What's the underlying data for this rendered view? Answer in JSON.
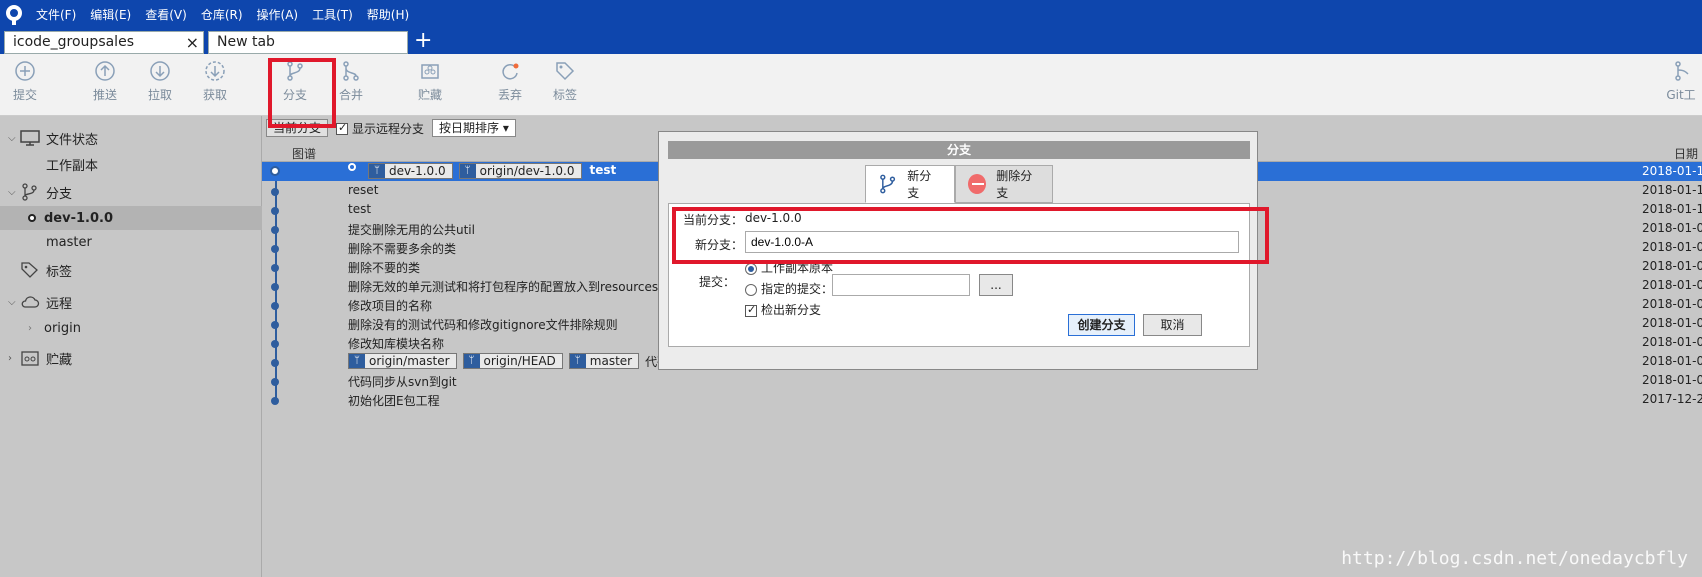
{
  "menubar": {
    "items": [
      "文件(F)",
      "编辑(E)",
      "查看(V)",
      "仓库(R)",
      "操作(A)",
      "工具(T)",
      "帮助(H)"
    ]
  },
  "tabs": [
    {
      "label": "icode_groupsales",
      "close": "×"
    },
    {
      "label": "New tab"
    }
  ],
  "tab_add": "+",
  "toolbar": {
    "commit": "提交",
    "push": "推送",
    "pull": "拉取",
    "fetch": "获取",
    "branch": "分支",
    "merge": "合并",
    "stash": "贮藏",
    "discard": "丢弃",
    "tag": "标签",
    "git_flow": "Git工"
  },
  "sidebar": {
    "file_status": "文件状态",
    "working_copy": "工作副本",
    "branches": "分支",
    "branch_current": "dev-1.0.0",
    "branch_master": "master",
    "tags": "标签",
    "remotes": "远程",
    "origin": "origin",
    "stashes": "贮藏"
  },
  "repo_controls": {
    "current_branch_btn": "当前分支",
    "show_remote": "显示远程分支",
    "sort": "按日期排序"
  },
  "columns": {
    "graph": "图谱",
    "date": "日期"
  },
  "commits": [
    {
      "refs": [
        "dev-1.0.0",
        "origin/dev-1.0.0"
      ],
      "tag": "test",
      "msg": "",
      "date": "2018-01-1"
    },
    {
      "msg": "reset",
      "date": "2018-01-1"
    },
    {
      "msg": "test",
      "date": "2018-01-1"
    },
    {
      "msg": "提交删除无用的公共util",
      "date": "2018-01-0"
    },
    {
      "msg": "删除不需要多余的类",
      "date": "2018-01-0"
    },
    {
      "msg": "删除不要的类",
      "date": "2018-01-0"
    },
    {
      "msg": "删除无效的单元测试和将打包程序的配置放入到resources目",
      "date": "2018-01-0"
    },
    {
      "msg": "修改项目的名称",
      "date": "2018-01-0"
    },
    {
      "msg": "删除没有的测试代码和修改gitignore文件排除规则",
      "date": "2018-01-0"
    },
    {
      "msg": "修改知库模块名称",
      "date": "2018-01-0"
    },
    {
      "refs": [
        "origin/master",
        "origin/HEAD",
        "master"
      ],
      "msg": "代码",
      "date": "2018-01-0"
    },
    {
      "msg": "代码同步从svn到git",
      "date": "2018-01-0"
    },
    {
      "msg": "初始化团E包工程",
      "date": "2017-12-2"
    }
  ],
  "dialog": {
    "title": "分支",
    "tab_new": "新分支",
    "tab_delete": "删除分支",
    "current_branch_label": "当前分支：",
    "current_branch_value": "dev-1.0.0",
    "new_branch_label": "新分支：",
    "new_branch_value": "dev-1.0.0-A",
    "commit_label": "提交：",
    "opt_working_copy": "工作副本原本",
    "opt_specified": "指定的提交：",
    "browse": "...",
    "checkout_new": "检出新分支",
    "create_btn": "创建分支",
    "cancel_btn": "取消"
  },
  "watermark": "http://blog.csdn.net/onedaycbfly",
  "colors": {
    "menubar_bg": "#0e46ad",
    "highlight_red": "#e0182b",
    "selected_row": "#2a6fd6"
  }
}
